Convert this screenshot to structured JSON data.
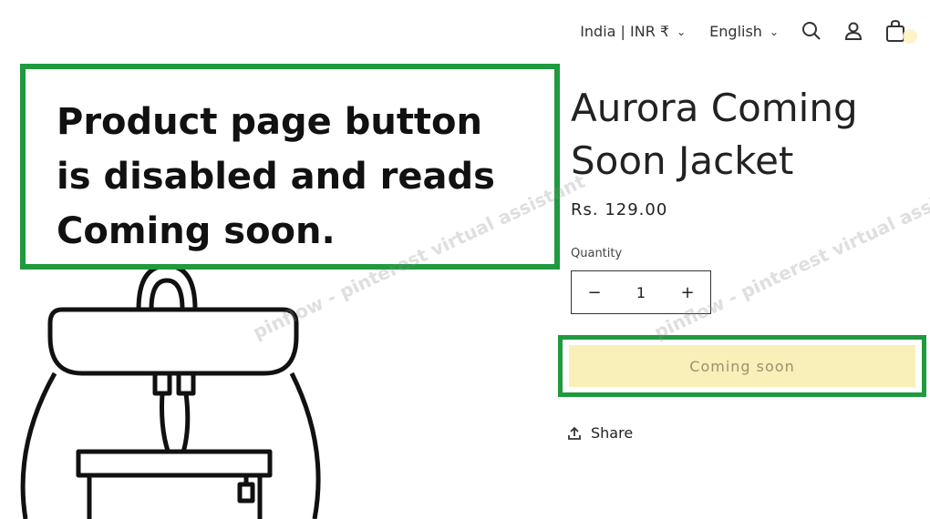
{
  "header": {
    "country_currency": "India | INR ₹",
    "language": "English",
    "icons": [
      "search-icon",
      "account-icon",
      "cart-icon"
    ]
  },
  "annotation": {
    "line1": "Product page button",
    "line2": "is disabled and reads",
    "line3": "Coming soon.",
    "border_color": "#1f9a3e"
  },
  "product": {
    "title_line1": "Aurora Coming",
    "title_line2": "Soon Jacket",
    "price": "Rs. 129.00",
    "quantity_label": "Quantity",
    "quantity_value": "1",
    "qty_minus": "−",
    "qty_plus": "+",
    "button_label": "Coming soon",
    "button_color": "#f9efb8",
    "share_label": "Share"
  },
  "watermark": {
    "text1": "pinflow - pinterest virtual assistant",
    "text2": "pinflow - pinterest virtual assistant"
  }
}
